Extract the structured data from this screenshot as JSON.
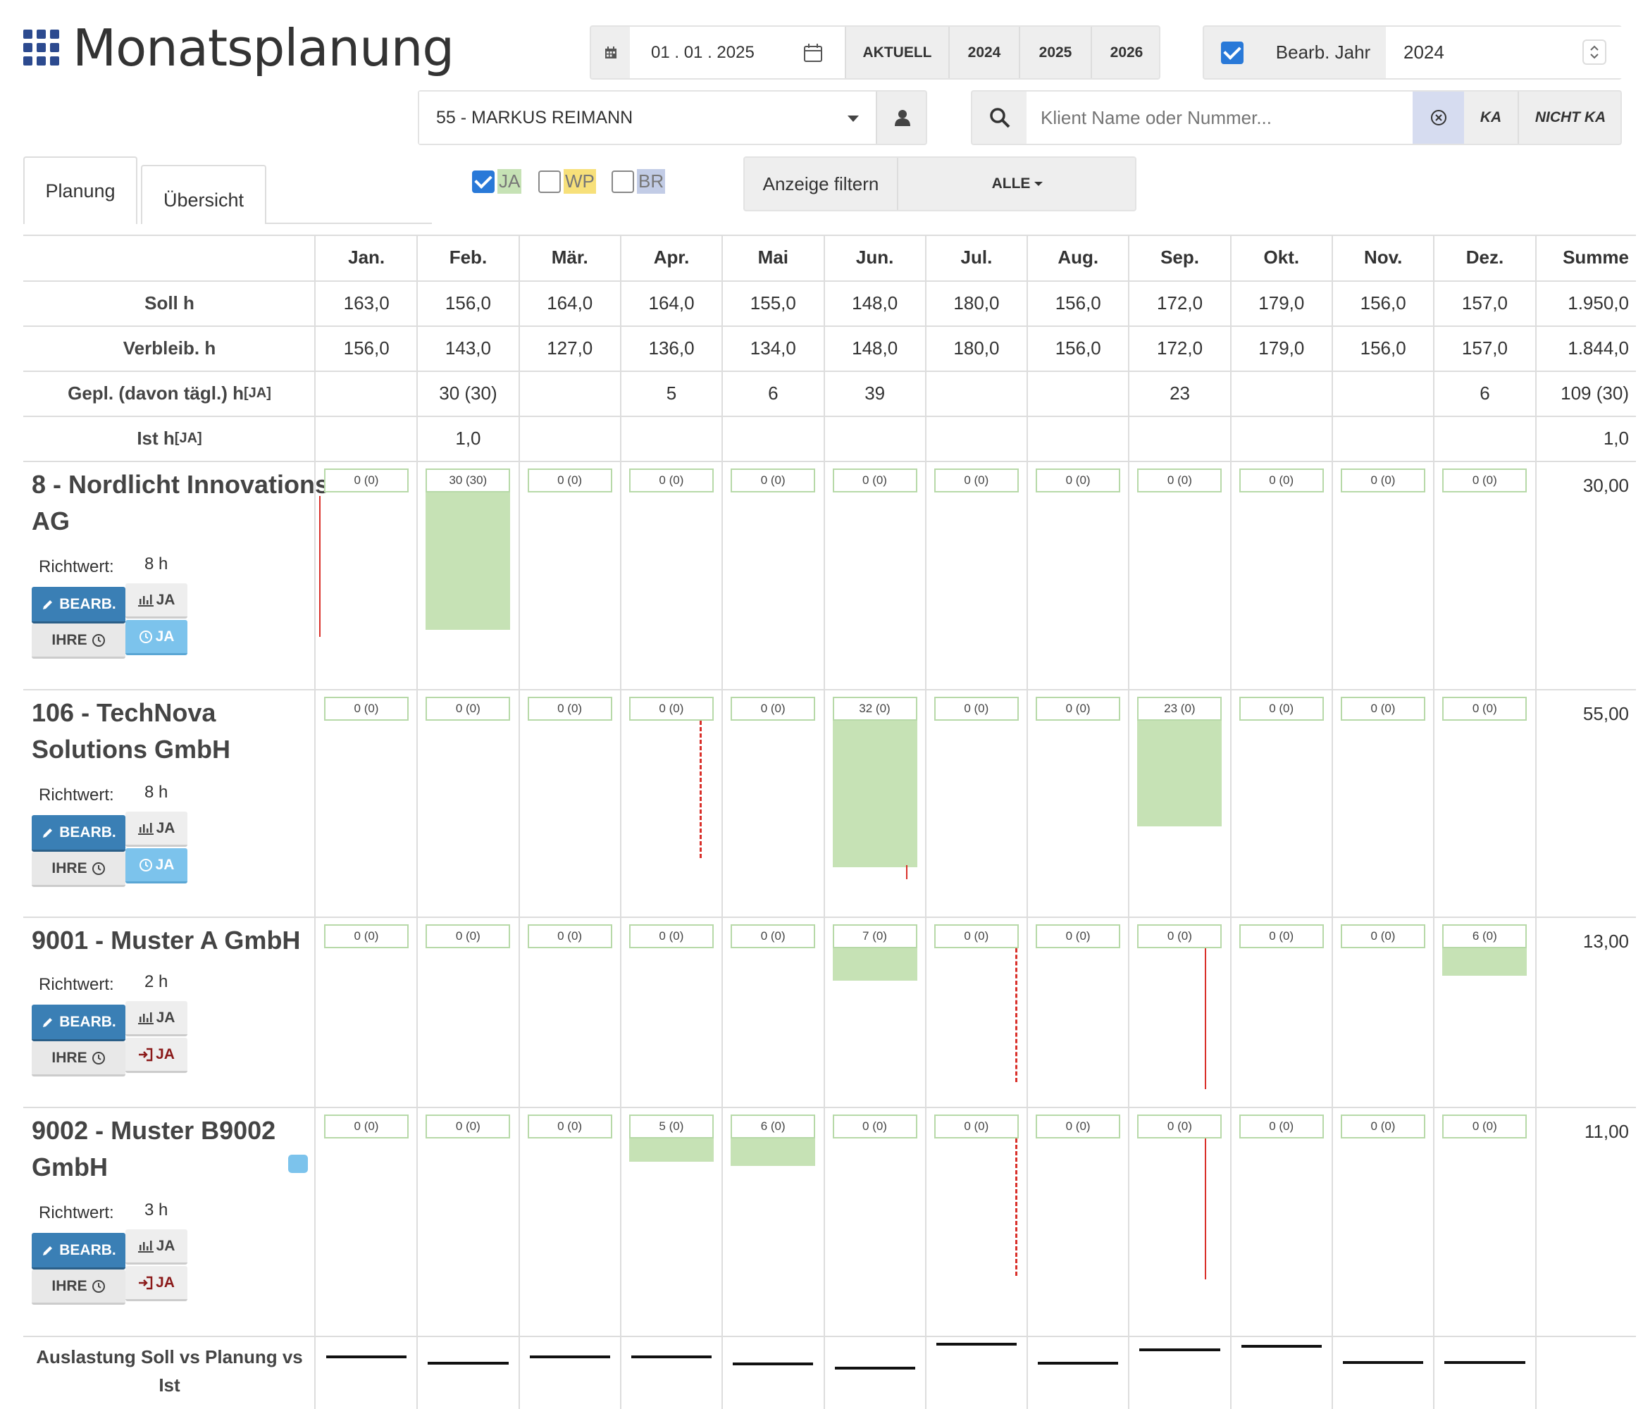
{
  "app": {
    "title": "Monatsplanung"
  },
  "toolbar": {
    "date_value": "01 . 01 . 2025",
    "btn_aktuell": "AKTUELL",
    "btn_2024": "2024",
    "btn_2025": "2025",
    "btn_2026": "2026",
    "bearb_jahr_label": "Bearb. Jahr",
    "bearb_jahr_value": "2024",
    "employee_select": "55 - MARKUS REIMANN",
    "search_placeholder": "Klient Name oder Nummer...",
    "btn_ka": "KA",
    "btn_nicht_ka": "NICHT KA",
    "filters": [
      {
        "label": "JA",
        "checked": true,
        "color": "#c6e2b5"
      },
      {
        "label": "WP",
        "checked": false,
        "color": "#f7e07a"
      },
      {
        "label": "BR",
        "checked": false,
        "color": "#c2cce6"
      }
    ],
    "anzeige_filtern": "Anzeige filtern",
    "alle": "ALLE"
  },
  "tabs": [
    {
      "label": "Planung",
      "active": true
    },
    {
      "label": "Übersicht",
      "active": false
    }
  ],
  "table": {
    "months": [
      "Jan.",
      "Feb.",
      "Mär.",
      "Apr.",
      "Mai",
      "Jun.",
      "Jul.",
      "Aug.",
      "Sep.",
      "Okt.",
      "Nov.",
      "Dez."
    ],
    "sum_label": "Summe",
    "rows": [
      {
        "label": "Soll h",
        "suffix": "",
        "values": [
          "163,0",
          "156,0",
          "164,0",
          "164,0",
          "155,0",
          "148,0",
          "180,0",
          "156,0",
          "172,0",
          "179,0",
          "156,0",
          "157,0"
        ],
        "sum": "1.950,0"
      },
      {
        "label": "Verbleib. h",
        "suffix": "",
        "values": [
          "156,0",
          "143,0",
          "127,0",
          "136,0",
          "134,0",
          "148,0",
          "180,0",
          "156,0",
          "172,0",
          "179,0",
          "156,0",
          "157,0"
        ],
        "sum": "1.844,0"
      },
      {
        "label": "Gepl. (davon tägl.) h",
        "suffix": "[JA]",
        "values": [
          "",
          "30 (30)",
          "",
          "5",
          "6",
          "39",
          "",
          "",
          "23",
          "",
          "",
          "6"
        ],
        "sum": "109 (30)"
      },
      {
        "label": "Ist h",
        "suffix": "[JA]",
        "values": [
          "",
          "1,0",
          "",
          "",
          "",
          "",
          "",
          "",
          "",
          "",
          "",
          ""
        ],
        "sum": "1,0"
      }
    ]
  },
  "clients": [
    {
      "name_line1": "8 - Nordlicht Innovations",
      "name_line2": "AG",
      "richtwert_label": "Richtwert:",
      "richtwert": "8 h",
      "sum": "30,00",
      "edit": "BEARB.",
      "ihre": "IHRE",
      "ja1": "JA",
      "ja2": "JA",
      "ja2_style": "clock",
      "boxes": [
        "0 (0)",
        "30 (30)",
        "0 (0)",
        "0 (0)",
        "0 (0)",
        "0 (0)",
        "0 (0)",
        "0 (0)",
        "0 (0)",
        "0 (0)",
        "0 (0)",
        "0 (0)"
      ],
      "bars": [
        0,
        30,
        0,
        0,
        0,
        0,
        0,
        0,
        0,
        0,
        0,
        0
      ]
    },
    {
      "name_line1": "106 - TechNova",
      "name_line2": "Solutions GmbH",
      "richtwert_label": "Richtwert:",
      "richtwert": "8 h",
      "sum": "55,00",
      "edit": "BEARB.",
      "ihre": "IHRE",
      "ja1": "JA",
      "ja2": "JA",
      "ja2_style": "clock",
      "boxes": [
        "0 (0)",
        "0 (0)",
        "0 (0)",
        "0 (0)",
        "0 (0)",
        "32 (0)",
        "0 (0)",
        "0 (0)",
        "23 (0)",
        "0 (0)",
        "0 (0)",
        "0 (0)"
      ],
      "bars": [
        0,
        0,
        0,
        0,
        0,
        32,
        0,
        0,
        23,
        0,
        0,
        0
      ]
    },
    {
      "name_line1": "9001 - Muster A GmbH",
      "name_line2": "",
      "richtwert_label": "Richtwert:",
      "richtwert": "2 h",
      "sum": "13,00",
      "edit": "BEARB.",
      "ihre": "IHRE",
      "ja1": "JA",
      "ja2": "JA",
      "ja2_style": "signin",
      "boxes": [
        "0 (0)",
        "0 (0)",
        "0 (0)",
        "0 (0)",
        "0 (0)",
        "7 (0)",
        "0 (0)",
        "0 (0)",
        "0 (0)",
        "0 (0)",
        "0 (0)",
        "6 (0)"
      ],
      "bars": [
        0,
        0,
        0,
        0,
        0,
        7,
        0,
        0,
        0,
        0,
        0,
        6
      ]
    },
    {
      "name_line1": "9002 - Muster B9002",
      "name_line2": "GmbH",
      "richtwert_label": "Richtwert:",
      "richtwert": "3 h",
      "sum": "11,00",
      "edit": "BEARB.",
      "ihre": "IHRE",
      "ja1": "JA",
      "ja2": "JA",
      "ja2_style": "signin",
      "boxes": [
        "0 (0)",
        "0 (0)",
        "0 (0)",
        "5 (0)",
        "6 (0)",
        "0 (0)",
        "0 (0)",
        "0 (0)",
        "0 (0)",
        "0 (0)",
        "0 (0)",
        "0 (0)"
      ],
      "bars": [
        0,
        0,
        0,
        5,
        6,
        0,
        0,
        0,
        0,
        0,
        0,
        0
      ]
    }
  ],
  "auslastung": {
    "label_line1": "Auslastung Soll vs Planung vs",
    "label_line2": "Ist"
  }
}
